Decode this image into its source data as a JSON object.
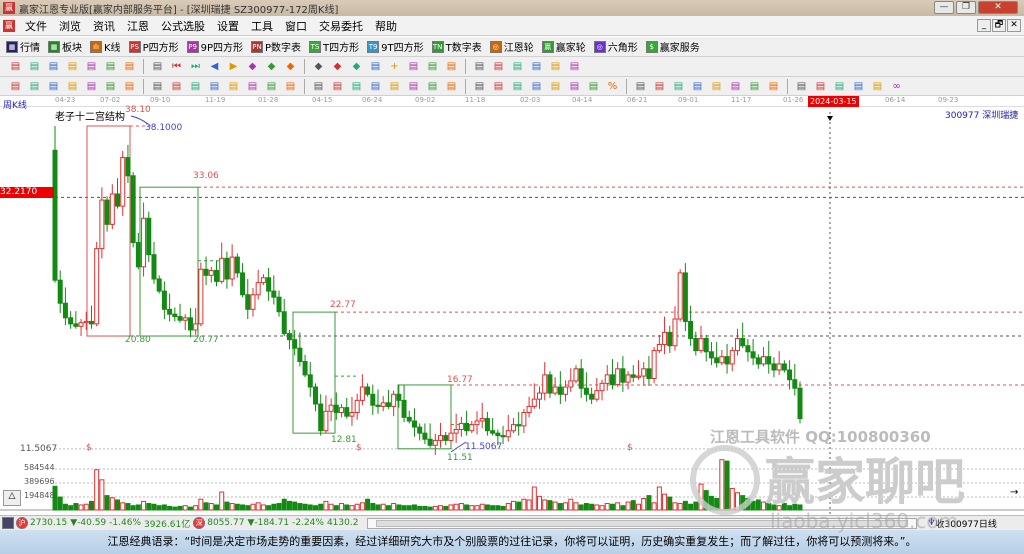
{
  "window": {
    "title": "赢家江恩专业版[赢家内部服务平台] - [深圳瑞捷  SZ300977-172周K线]",
    "minimize": "—",
    "restore": "❐",
    "close": "✕"
  },
  "menu": [
    "文件",
    "浏览",
    "资讯",
    "江恩",
    "公式选股",
    "设置",
    "工具",
    "窗口",
    "交易委托",
    "帮助"
  ],
  "mdi": [
    "_",
    "🗗",
    "✕"
  ],
  "toolbar1": [
    {
      "label": "行情",
      "icon": "grid-icon",
      "tag": "▦",
      "color": "#226"
    },
    {
      "label": "板块",
      "icon": "blocks-icon",
      "tag": "▦",
      "color": "#282"
    },
    {
      "label": "K线",
      "icon": "candles-icon",
      "tag": "ılı",
      "color": "#c60"
    },
    {
      "label": "P四方形",
      "icon": "p-square-icon",
      "tag": "PS",
      "color": "#c33"
    },
    {
      "label": "9P四方形",
      "icon": "9p-square-icon",
      "tag": "P9",
      "color": "#a3a"
    },
    {
      "label": "P数字表",
      "icon": "p-number-icon",
      "tag": "PN",
      "color": "#a33"
    },
    {
      "label": "T四方形",
      "icon": "t-square-icon",
      "tag": "TS",
      "color": "#3a3"
    },
    {
      "label": "9T四方形",
      "icon": "9t-square-icon",
      "tag": "T9",
      "color": "#39c"
    },
    {
      "label": "T数字表",
      "icon": "t-number-icon",
      "tag": "TN",
      "color": "#393"
    },
    {
      "label": "江恩轮",
      "icon": "gann-wheel-icon",
      "tag": "◎",
      "color": "#c60"
    },
    {
      "label": "赢家轮",
      "icon": "winner-wheel-icon",
      "tag": "赢",
      "color": "#393"
    },
    {
      "label": "六角形",
      "icon": "hexagon-icon",
      "tag": "◎",
      "color": "#63c"
    },
    {
      "label": "赢家服务",
      "icon": "dollar-icon",
      "tag": "$",
      "color": "#3a3"
    }
  ],
  "toolbar2_icons": [
    "save",
    "chart-a",
    "chart-b",
    "chart-c",
    "chart-d",
    "updown",
    "marker",
    "flag",
    "first",
    "last",
    "left",
    "right",
    "diamond1",
    "diamond2",
    "diamond3",
    "diamond4",
    "diamond5",
    "diamond6",
    "hand",
    "crosshair",
    "draw",
    "bracket",
    "network",
    "calendar",
    "calculator",
    "table",
    "export",
    "print",
    "network2"
  ],
  "toolbar3_icons": [
    "pen",
    "lines",
    "gold1",
    "gold2",
    "fork",
    "fan",
    "pencil",
    "circle",
    "bars",
    "n2",
    "angle",
    "target",
    "star",
    "box",
    "wave",
    "speed1",
    "speed2",
    "grid",
    "range",
    "cycle",
    "fib1",
    "fib2",
    "fib3",
    "fan2",
    "zigzag",
    "grid2",
    "grid3",
    "lines2",
    "time",
    "pct",
    "percent",
    "gann",
    "coin",
    "gold",
    "arrow",
    "triangle",
    "gold3",
    "angle1",
    "angle2",
    "angle3",
    "angle4",
    "angle5",
    "angle6",
    "yinyang",
    "infinity"
  ],
  "chart": {
    "period_label": "周K线",
    "study_title": "老子十二宫结构",
    "symbol": "300977  深圳瑞捷",
    "dates": [
      "04-23",
      "07-02",
      "09-10",
      "11-19",
      "01-28",
      "04-15",
      "06-24",
      "09-02",
      "11-18",
      "02-03",
      "04-14",
      "06-21",
      "09-01",
      "11-17",
      "01-26",
      "06-14",
      "09-23"
    ],
    "cursor_date": "2024-03-15",
    "cursor_price": "32.2170",
    "low_price": "11.5067",
    "levels": {
      "h1": "38.10",
      "h1b": "38.1000",
      "h2": "33.06",
      "h3": "22.77",
      "h4": "16.77",
      "l1": "20.80",
      "l2": "20.77",
      "l3": "12.81",
      "l4": "11.51",
      "l4b": "11.5067"
    },
    "dollar": "$",
    "vol_ticks": [
      "584544",
      "389696",
      "194848"
    ],
    "watermark1": "江恩工具软件  QQ:100800360",
    "watermark2": "赢家聊吧",
    "watermark3": "liaoba.yicl360.com",
    "colors": {
      "up": "#e03030",
      "down": "#138a13",
      "box_red": "#e05050",
      "box_green": "#3a9a3a"
    }
  },
  "chart_data": {
    "type": "candlestick",
    "first_open": 36.1,
    "closes": [
      25.4,
      23.5,
      22.3,
      21.8,
      21.6,
      21.9,
      22.0,
      21.8,
      28.0,
      32.0,
      30.0,
      32.5,
      31.5,
      35.5,
      34.0,
      28.5,
      26.5,
      30.5,
      27.5,
      25.5,
      24.5,
      23.0,
      22.6,
      22.4,
      22.1,
      22.3,
      21.3,
      21.8,
      26.3,
      25.8,
      26.2,
      25.3,
      27.2,
      25.5,
      27.3,
      26.0,
      24.2,
      23.0,
      24.2,
      25.2,
      25.6,
      24.5,
      24.0,
      22.8,
      21.0,
      20.5,
      19.8,
      18.7,
      17.6,
      16.6,
      15.2,
      13.0,
      14.6,
      15.1,
      14.5,
      14.9,
      14.2,
      14.5,
      15.5,
      16.6,
      16.0,
      15.1,
      15.0,
      15.3,
      15.0,
      16.0,
      15.5,
      14.1,
      13.8,
      13.3,
      12.8,
      12.3,
      11.8,
      12.2,
      12.6,
      12.2,
      12.8,
      13.1,
      13.6,
      13.0,
      13.5,
      13.8,
      14.0,
      13.0,
      12.8,
      12.6,
      12.5,
      13.0,
      13.5,
      13.4,
      14.5,
      15.0,
      15.6,
      16.1,
      17.6,
      16.1,
      16.6,
      16.0,
      16.6,
      17.1,
      18.1,
      16.5,
      16.0,
      15.6,
      16.3,
      16.9,
      17.6,
      16.8,
      18.1,
      17.0,
      17.6,
      17.4,
      17.5,
      18.1,
      17.3,
      19.6,
      20.1,
      21.1,
      20.0,
      22.2,
      26.0,
      22.0,
      20.6,
      19.6,
      20.6,
      19.5,
      19.0,
      18.6,
      19.1,
      18.5,
      19.6,
      20.6,
      20.0,
      19.5,
      19.0,
      18.5,
      19.1,
      18.5,
      18.0,
      18.5,
      18.0,
      17.2,
      16.5,
      14.0
    ],
    "volumes": [
      330,
      180,
      80,
      60,
      90,
      70,
      80,
      120,
      560,
      420,
      200,
      170,
      140,
      100,
      90,
      60,
      70,
      120,
      90,
      80,
      60,
      70,
      50,
      40,
      50,
      60,
      40,
      60,
      150,
      100,
      90,
      70,
      250,
      110,
      90,
      80,
      70,
      60,
      80,
      100,
      70,
      60,
      80,
      90,
      150,
      120,
      110,
      90,
      80,
      70,
      60,
      80,
      120,
      80,
      60,
      90,
      70,
      60,
      80,
      100,
      150,
      90,
      70,
      80,
      60,
      90,
      70,
      60,
      60,
      70,
      50,
      50,
      40,
      50,
      60,
      50,
      70,
      80,
      90,
      70,
      60,
      60,
      80,
      70,
      60,
      60,
      50,
      90,
      120,
      110,
      150,
      140,
      320,
      190,
      140,
      130,
      110,
      90,
      100,
      150,
      100,
      70,
      90,
      80,
      70,
      60,
      90,
      80,
      100,
      60,
      110,
      130,
      80,
      160,
      200,
      100,
      320,
      220,
      180,
      100,
      90,
      120,
      80,
      110,
      360,
      270,
      190,
      160,
      700,
      680,
      300,
      240,
      200,
      160,
      120,
      140,
      110,
      90,
      70,
      60,
      90,
      60,
      80,
      70
    ],
    "price_range": [
      11.5067,
      38.1
    ],
    "volume_ticks": [
      194848,
      389696,
      584544
    ]
  },
  "status": {
    "sh_value": "2730.15",
    "sh_change": "▼-40.59",
    "sh_pct": "-1.46%",
    "sh_amount": "3926.61亿",
    "sz_value": "8055.77",
    "sz_change": "▼-184.71",
    "sz_pct": "-2.24%",
    "sz_amount": "4130.2",
    "right_text": "收300977日线",
    "sh_icon": "沪",
    "sz_icon": "深"
  },
  "quote": "江恩经典语录：“时间是决定市场走势的重要因素，经过详细研究大市及个别股票的过往记录，你将可以证明，历史确实重复发生；而了解过往，你将可以预测将来。”。"
}
